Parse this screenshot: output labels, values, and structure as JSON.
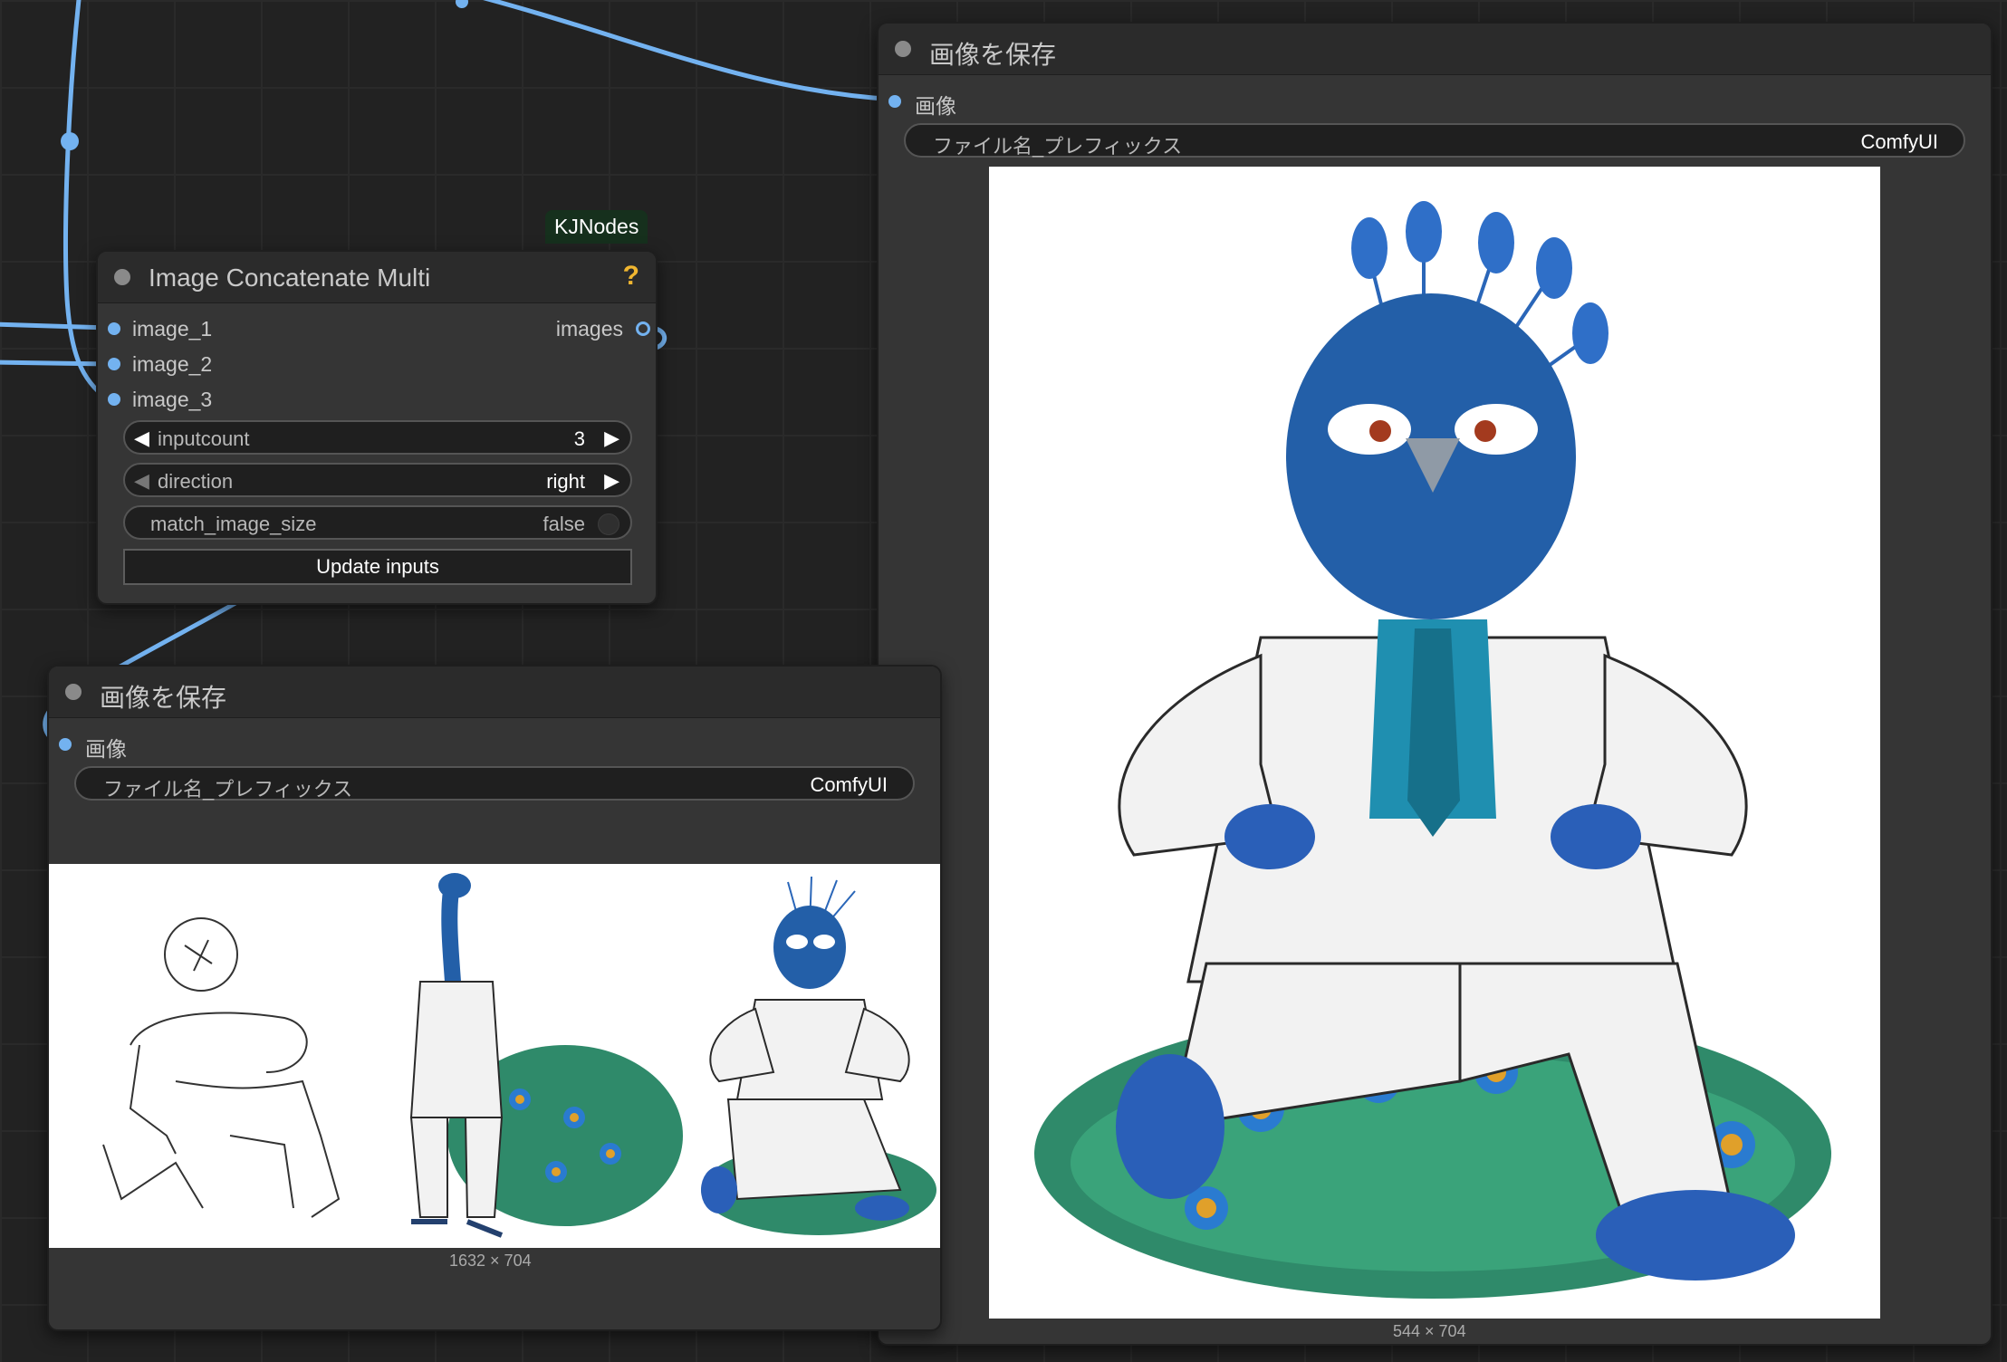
{
  "colors": {
    "canvas": "#222222",
    "node_body": "#353535",
    "node_header": "#2b2b2b",
    "wire": "#73b2f0",
    "help": "#f0b630",
    "badge_bg": "#16301d"
  },
  "concat_node": {
    "badge": "KJNodes",
    "title": "Image Concatenate Multi",
    "help_icon": "?",
    "inputs": [
      "image_1",
      "image_2",
      "image_3"
    ],
    "output": "images",
    "widgets": {
      "inputcount": {
        "label": "inputcount",
        "value": "3"
      },
      "direction": {
        "label": "direction",
        "value": "right"
      },
      "match_image_size": {
        "label": "match_image_size",
        "value": "false"
      }
    },
    "button": "Update inputs"
  },
  "save_node_right": {
    "title": "画像を保存",
    "input": "画像",
    "filename_label": "ファイル名_プレフィックス",
    "filename_value": "ComfyUI",
    "dims": "544 × 704"
  },
  "save_node_left": {
    "title": "画像を保存",
    "input": "画像",
    "filename_label": "ファイル名_プレフィックス",
    "filename_value": "ComfyUI",
    "dims": "1632 × 704"
  },
  "icons": {
    "peacock_image": "peacock-suit-icon",
    "sketch_image": "pose-sketch-icon"
  }
}
